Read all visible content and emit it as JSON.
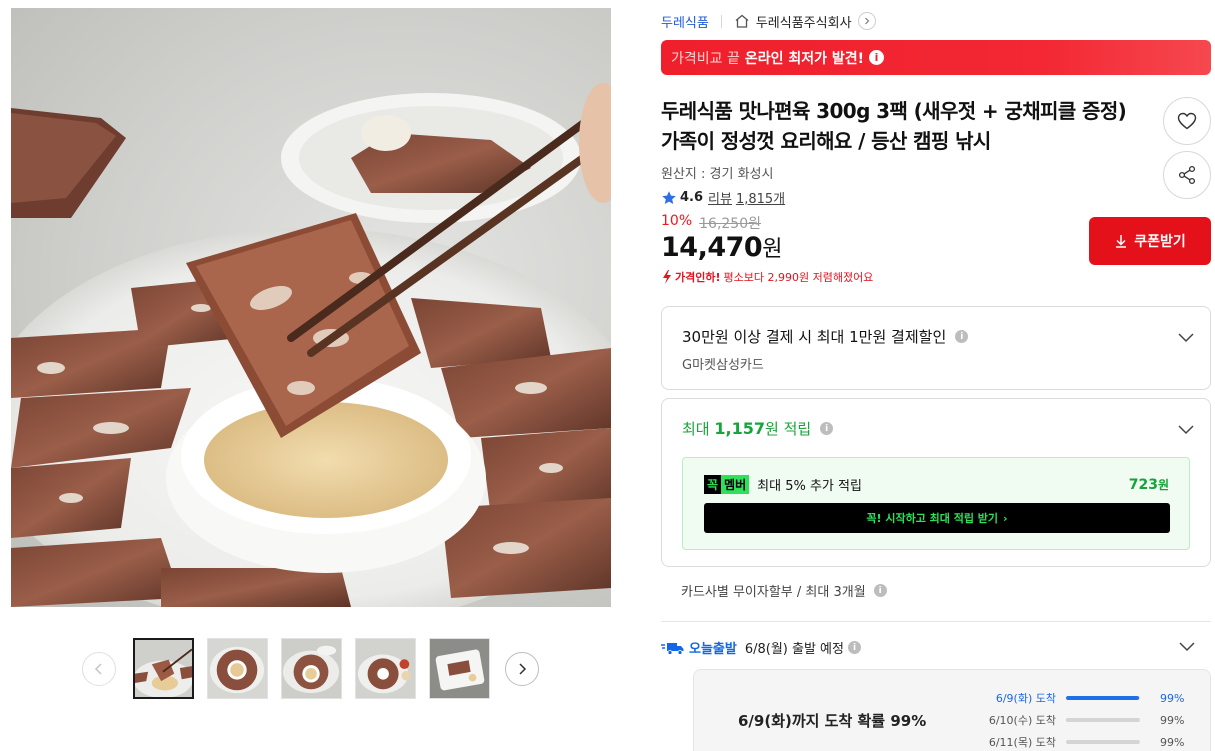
{
  "gallery": {
    "thumbnail_count": 5,
    "active_index": 0
  },
  "seller": {
    "brand": "두레식품",
    "store": "두레식품주식회사"
  },
  "promo": {
    "prefix": "가격비교 끝",
    "highlight": "온라인 최저가 발견!",
    "info_icon": "i",
    "color": "#ef1f2c"
  },
  "product": {
    "title": "두레식품 맛나편육 300g 3팩 (새우젓 + 궁채피클 증정) 가족이 정성껏 요리해요 / 등산 캠핑 낚시",
    "origin": "원산지 : 경기 화성시",
    "rating": "4.6",
    "review_label": "리뷰",
    "review_count": "1,815개",
    "discount_rate": "10%",
    "original_price": "16,250원",
    "sale_price": "14,470",
    "currency": "원",
    "price_drop_strong": "가격인하!",
    "price_drop_text": "평소보다 2,990원 저렴해졌어요"
  },
  "actions": {
    "coupon_label": "쿠폰받기",
    "wish_icon": "heart-icon",
    "share_icon": "share-icon"
  },
  "card_benefit": {
    "title": "30만원 이상 결제 시 최대 1만원 결제할인",
    "card_name": "G마켓삼성카드"
  },
  "points": {
    "prefix": "최대",
    "amount": "1,157",
    "unit": "원",
    "suffix": "적립",
    "member_badge_a": "꼭",
    "member_badge_b": "멤버",
    "member_text": "최대 5% 추가 적립",
    "member_amount": "723",
    "member_unit": "원",
    "member_cta": "꼭! 시작하고 최대 적립 받기",
    "member_cta_arrow": "›"
  },
  "installment": "카드사별 무이자할부 / 최대 3개월",
  "shipping": {
    "badge": "오늘출발",
    "text": "6/8(월) 출발 예정",
    "arrival_title": "6/9(화)까지 도착 확률 99%",
    "probabilities": [
      {
        "date": "6/9(화) 도착",
        "value": 0.99,
        "pct": "99%"
      },
      {
        "date": "6/10(수) 도착",
        "value": 0.99,
        "pct": "99%"
      },
      {
        "date": "6/11(목) 도착",
        "value": 0.99,
        "pct": "99%"
      }
    ]
  }
}
